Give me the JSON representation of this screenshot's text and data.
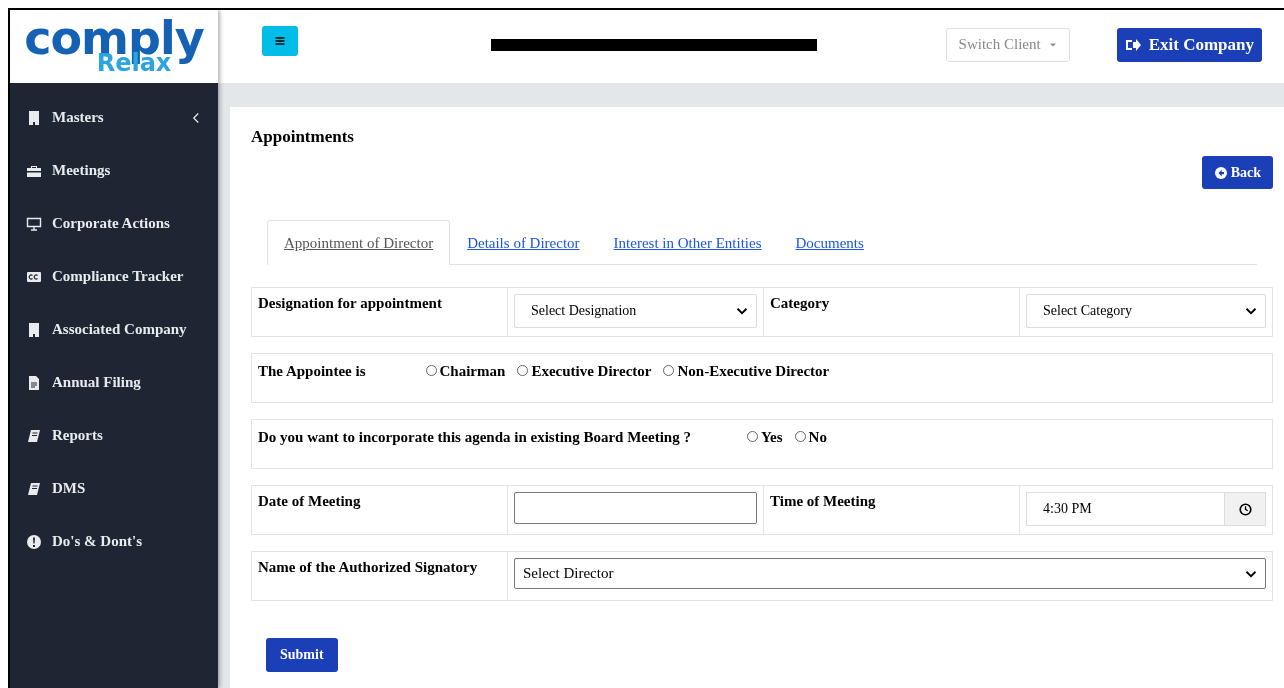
{
  "logo": {
    "word": "comply",
    "subword": "Relax"
  },
  "header": {
    "switch_client": "Switch Client",
    "exit_button": "Exit Company"
  },
  "sidebar": {
    "items": [
      {
        "label": "Masters",
        "expanded": false
      },
      {
        "label": "Meetings"
      },
      {
        "label": "Corporate Actions"
      },
      {
        "label": "Compliance Tracker"
      },
      {
        "label": "Associated Company"
      },
      {
        "label": "Annual Filing"
      },
      {
        "label": "Reports"
      },
      {
        "label": "DMS"
      },
      {
        "label": "Do's & Dont's"
      }
    ]
  },
  "page": {
    "title": "Appointments",
    "back_button": "Back",
    "tabs": [
      {
        "label": "Appointment of Director",
        "selected": true
      },
      {
        "label": "Details of Director",
        "selected": false
      },
      {
        "label": "Interest in Other Entities",
        "selected": false
      },
      {
        "label": "Documents",
        "selected": false
      }
    ],
    "rows": [
      {
        "kind": "pair",
        "cells": [
          {
            "label": "Designation for appointment",
            "control": {
              "kind": "select",
              "value": "Select Designation"
            }
          },
          {
            "label": "Category",
            "control": {
              "kind": "select",
              "value": "Select Category"
            }
          }
        ]
      },
      {
        "kind": "radios",
        "label": "The Appointee is",
        "options": [
          {
            "label": "Chairman",
            "selected": false
          },
          {
            "label": "Executive Director",
            "selected": false
          },
          {
            "label": "Non-Executive Director",
            "selected": false
          }
        ]
      },
      {
        "kind": "radios",
        "label": "Do you want to incorporate this agenda in existing Board Meeting ?",
        "options": [
          {
            "label": "Yes",
            "selected": false
          },
          {
            "label": "No",
            "selected": false
          }
        ]
      },
      {
        "kind": "pair",
        "cells": [
          {
            "label": "Date of Meeting",
            "control": {
              "kind": "text"
            }
          },
          {
            "label": "Time of Meeting",
            "control": {
              "kind": "time",
              "value": "4:30 PM"
            }
          }
        ]
      },
      {
        "kind": "wide",
        "label": "Name of the Authorized Signatory",
        "control": {
          "kind": "select",
          "value": "Select Director"
        }
      }
    ],
    "submit_button": "Submit"
  }
}
